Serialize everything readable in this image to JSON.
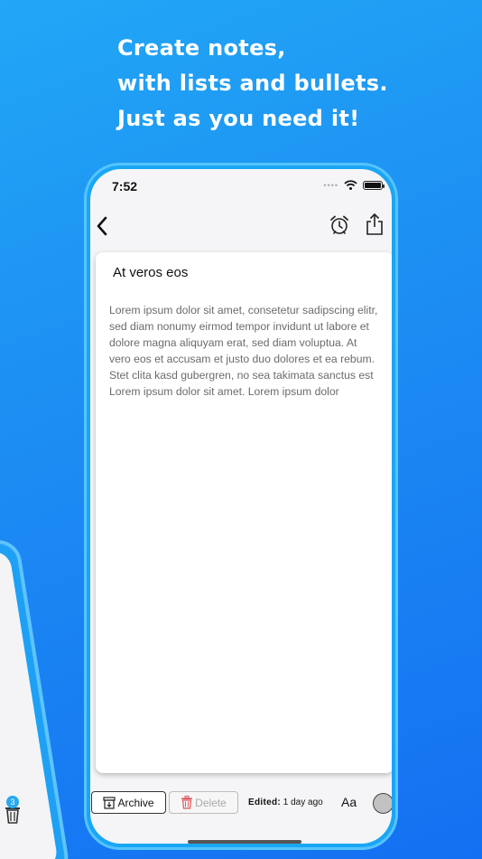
{
  "headline": {
    "line1": "Create notes,",
    "line2": "with lists and bullets.",
    "line3": "Just as you need it!"
  },
  "side_phone": {
    "trash_badge": "3"
  },
  "status_bar": {
    "time": "7:52"
  },
  "note": {
    "title": "At veros eos",
    "body": "Lorem ipsum dolor sit amet, consetetur sadipscing elitr, sed diam nonumy eirmod tempor invidunt ut labore et dolore magna aliquyam erat, sed diam voluptua. At vero eos et accusam et justo duo dolores et ea rebum. Stet clita kasd gubergren, no sea takimata sanctus est Lorem ipsum dolor sit amet. Lorem ipsum dolor"
  },
  "toolbar": {
    "archive_label": "Archive",
    "delete_label": "Delete",
    "edited_label": "Edited:",
    "edited_value": "1 day ago",
    "font_size_label": "Aa"
  },
  "icons": {
    "back": "chevron-left-icon",
    "alarm": "alarm-clock-icon",
    "share": "share-icon",
    "archive": "archive-box-icon",
    "delete": "trash-icon",
    "wifi": "wifi-icon",
    "battery": "battery-icon"
  },
  "colors": {
    "background_start": "#21a7f6",
    "background_end": "#1470f2",
    "delete_icon": "#e0555a",
    "note_text": "#6b6b6b"
  }
}
